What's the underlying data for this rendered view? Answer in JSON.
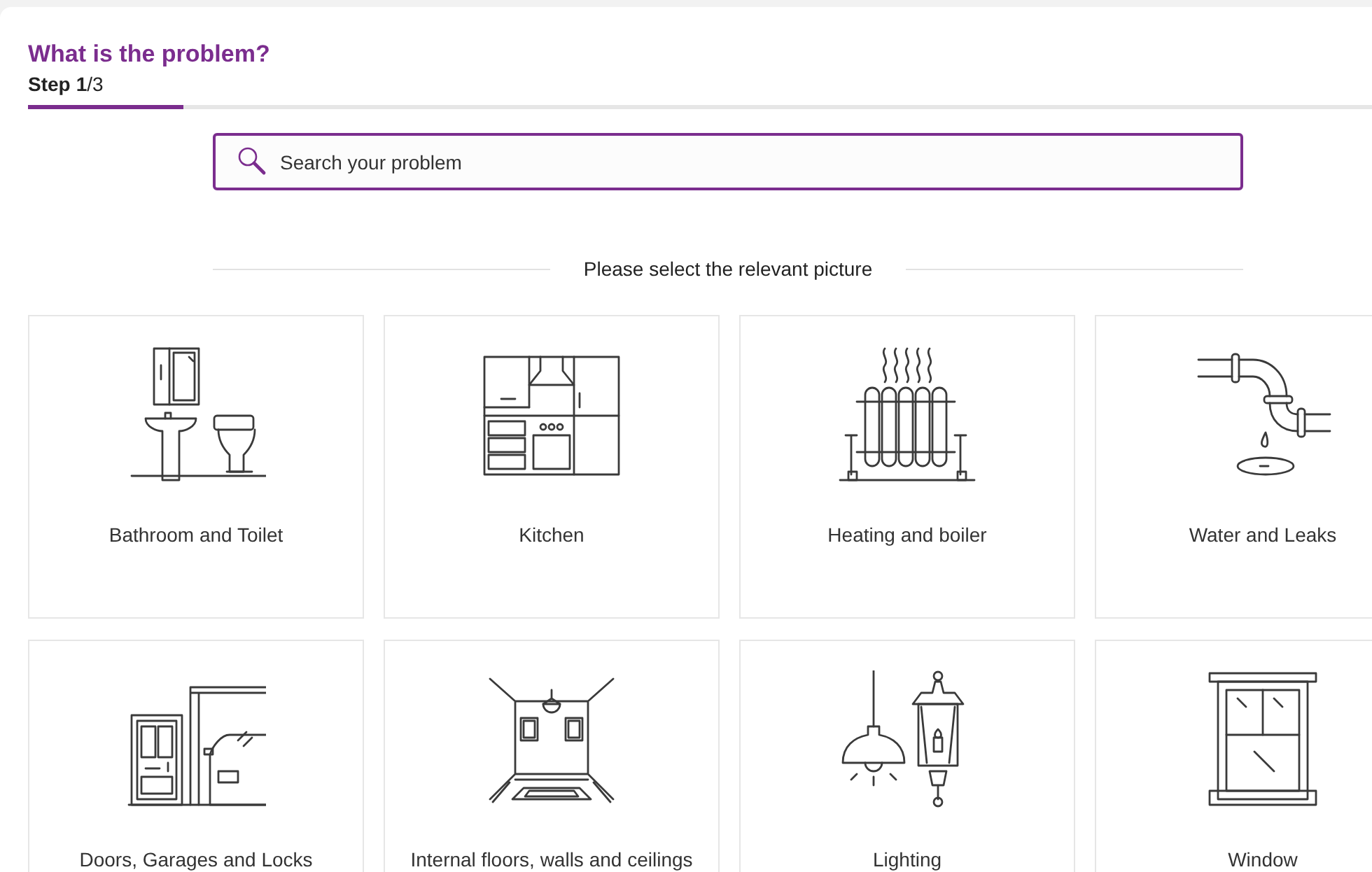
{
  "header": {
    "title": "What is the problem?",
    "step_label": "Step",
    "step_current": "1",
    "step_total": "/3",
    "progress": {
      "level": 0.116
    }
  },
  "search": {
    "placeholder": "Search your problem"
  },
  "prompt": "Please select the relevant picture",
  "categories": [
    {
      "label": "Bathroom and Toilet",
      "kind": "bathroom"
    },
    {
      "label": "Kitchen",
      "kind": "kitchen"
    },
    {
      "label": "Heating and boiler",
      "kind": "heating"
    },
    {
      "label": "Water and Leaks",
      "kind": "water"
    },
    {
      "label": "Doors, Garages and Locks",
      "kind": "doors"
    },
    {
      "label": "Internal floors, walls and ceilings",
      "kind": "interior"
    },
    {
      "label": "Lighting",
      "kind": "lighting"
    },
    {
      "label": "Window",
      "kind": "window"
    }
  ]
}
